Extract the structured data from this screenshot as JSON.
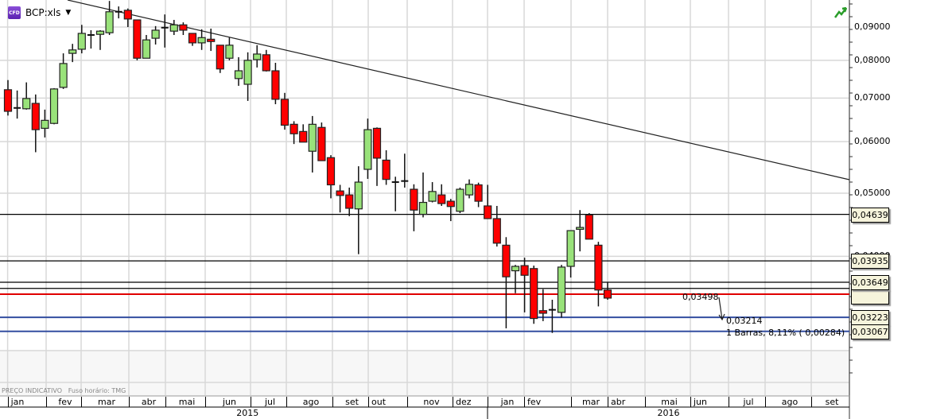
{
  "header": {
    "symbol": "BCP:xls",
    "badge": "CFD",
    "dropdown_icon": "caret-down-icon",
    "trend_icon": "green-trend-arrow-icon"
  },
  "status": {
    "price_note": "PREÇO INDICATIVO",
    "timezone": "Fuso horário: TMG"
  },
  "colors": {
    "up": "#99e27a",
    "down": "#ff0000",
    "support": "#334ea0",
    "current": "#e00000",
    "grid": "#d8d8d8",
    "label_bg": "#f6f4dc"
  },
  "chart_data": {
    "type": "candlestick",
    "scale": "log",
    "interval": "weekly",
    "ylim": [
      0.0255,
      0.099
    ],
    "y_ticks": [
      {
        "v": 0.09,
        "label": "0,09000"
      },
      {
        "v": 0.08,
        "label": "0,08000"
      },
      {
        "v": 0.07,
        "label": "0,07000"
      },
      {
        "v": 0.06,
        "label": "0,06000"
      },
      {
        "v": 0.05,
        "label": "0,05000"
      },
      {
        "v": 0.04,
        "label": "0,04000"
      }
    ],
    "candles": [
      [
        0.0721,
        0.0746,
        0.0658,
        0.0668
      ],
      [
        0.0676,
        0.0719,
        0.0651,
        0.0676
      ],
      [
        0.0674,
        0.074,
        0.0672,
        0.0699
      ],
      [
        0.0687,
        0.0709,
        0.0578,
        0.0626
      ],
      [
        0.0629,
        0.0672,
        0.0609,
        0.0647
      ],
      [
        0.064,
        0.0725,
        0.0638,
        0.0723
      ],
      [
        0.0727,
        0.082,
        0.0723,
        0.0791
      ],
      [
        0.082,
        0.0848,
        0.0795,
        0.083
      ],
      [
        0.0832,
        0.0907,
        0.082,
        0.088
      ],
      [
        0.0875,
        0.089,
        0.0834,
        0.0875
      ],
      [
        0.0877,
        0.089,
        0.083,
        0.0887
      ],
      [
        0.0882,
        0.0987,
        0.0875,
        0.095
      ],
      [
        0.095,
        0.0968,
        0.0928,
        0.095
      ],
      [
        0.0955,
        0.0961,
        0.09,
        0.0926
      ],
      [
        0.0923,
        0.0923,
        0.08,
        0.0806
      ],
      [
        0.0806,
        0.0875,
        0.0806,
        0.086
      ],
      [
        0.0865,
        0.0903,
        0.0846,
        0.089
      ],
      [
        0.0898,
        0.0941,
        0.0837,
        0.0898
      ],
      [
        0.0887,
        0.0923,
        0.0875,
        0.0907
      ],
      [
        0.0907,
        0.0915,
        0.0875,
        0.089
      ],
      [
        0.088,
        0.088,
        0.0842,
        0.0851
      ],
      [
        0.0851,
        0.0893,
        0.083,
        0.0867
      ],
      [
        0.0862,
        0.0895,
        0.0827,
        0.0855
      ],
      [
        0.0844,
        0.0844,
        0.0765,
        0.0776
      ],
      [
        0.0806,
        0.0867,
        0.08,
        0.0844
      ],
      [
        0.075,
        0.0809,
        0.0731,
        0.0771
      ],
      [
        0.0735,
        0.0823,
        0.0693,
        0.08
      ],
      [
        0.0802,
        0.0844,
        0.078,
        0.0818
      ],
      [
        0.0816,
        0.083,
        0.0769,
        0.0771
      ],
      [
        0.0771,
        0.0793,
        0.0685,
        0.0697
      ],
      [
        0.0697,
        0.0713,
        0.0626,
        0.0636
      ],
      [
        0.0638,
        0.0645,
        0.0595,
        0.0617
      ],
      [
        0.0622,
        0.0638,
        0.0599,
        0.0599
      ],
      [
        0.058,
        0.0657,
        0.0538,
        0.0638
      ],
      [
        0.0631,
        0.0642,
        0.0561,
        0.0561
      ],
      [
        0.0567,
        0.0572,
        0.0491,
        0.0515
      ],
      [
        0.0504,
        0.0515,
        0.0467,
        0.0496
      ],
      [
        0.0497,
        0.051,
        0.0461,
        0.0474
      ],
      [
        0.0473,
        0.055,
        0.0403,
        0.052
      ],
      [
        0.0544,
        0.0651,
        0.0526,
        0.0626
      ],
      [
        0.0629,
        0.0631,
        0.0513,
        0.0566
      ],
      [
        0.0562,
        0.0582,
        0.0515,
        0.0525
      ],
      [
        0.052,
        0.053,
        0.0469,
        0.052
      ],
      [
        0.0522,
        0.0575,
        0.051,
        0.0522
      ],
      [
        0.0507,
        0.0516,
        0.0437,
        0.0471
      ],
      [
        0.0464,
        0.0538,
        0.0459,
        0.0484
      ],
      [
        0.0486,
        0.052,
        0.0484,
        0.0503
      ],
      [
        0.0497,
        0.0516,
        0.0478,
        0.0482
      ],
      [
        0.0486,
        0.049,
        0.0453,
        0.0477
      ],
      [
        0.0469,
        0.051,
        0.0466,
        0.0507
      ],
      [
        0.0497,
        0.0525,
        0.0491,
        0.0516
      ],
      [
        0.0515,
        0.0519,
        0.0476,
        0.0486
      ],
      [
        0.0478,
        0.0515,
        0.0457,
        0.0457
      ],
      [
        0.0457,
        0.0478,
        0.0414,
        0.0419
      ],
      [
        0.0416,
        0.0428,
        0.031,
        0.0372
      ],
      [
        0.038,
        0.0388,
        0.0351,
        0.0386
      ],
      [
        0.0387,
        0.0398,
        0.0328,
        0.0374
      ],
      [
        0.0383,
        0.0387,
        0.0315,
        0.0321
      ],
      [
        0.033,
        0.0356,
        0.0318,
        0.0327
      ],
      [
        0.0331,
        0.0343,
        0.0305,
        0.0331
      ],
      [
        0.0328,
        0.0388,
        0.0322,
        0.0385
      ],
      [
        0.0386,
        0.0438,
        0.0371,
        0.0438
      ],
      [
        0.044,
        0.0471,
        0.0407,
        0.0443
      ],
      [
        0.0463,
        0.0466,
        0.0425,
        0.0425
      ],
      [
        0.0416,
        0.0421,
        0.0335,
        0.0355
      ],
      [
        0.0355,
        0.0365,
        0.0343,
        0.0345
      ]
    ],
    "candle_fields": [
      "open",
      "high",
      "low",
      "close"
    ],
    "horizontal_lines": [
      {
        "v": 0.04639,
        "label": "0,04639",
        "color": "#000000"
      },
      {
        "v": 0.03935,
        "label": "0,03935",
        "color": "#000000"
      },
      {
        "v": 0.03649,
        "label": "0,03649",
        "color": "#000000"
      },
      {
        "v": 0.03498,
        "label": "",
        "color": "#e00000"
      },
      {
        "v": 0.03223,
        "label": "0,03223",
        "color": "#334ea0"
      },
      {
        "v": 0.03067,
        "label": "0,03067",
        "color": "#334ea0"
      }
    ],
    "measure": {
      "from_label": "0,03498",
      "to_label": "0,03214",
      "summary": "1 Barras,  8,11% ( 0,00284)"
    },
    "months": [
      "jan",
      "fev",
      "mar",
      "abr",
      "mai",
      "jun",
      "jul",
      "ago",
      "set",
      "out",
      "nov",
      "dez",
      "jan",
      "fev",
      "mar",
      "abr",
      "mai",
      "jun",
      "jul",
      "ago",
      "set"
    ],
    "years": [
      "2015",
      "2016"
    ]
  }
}
